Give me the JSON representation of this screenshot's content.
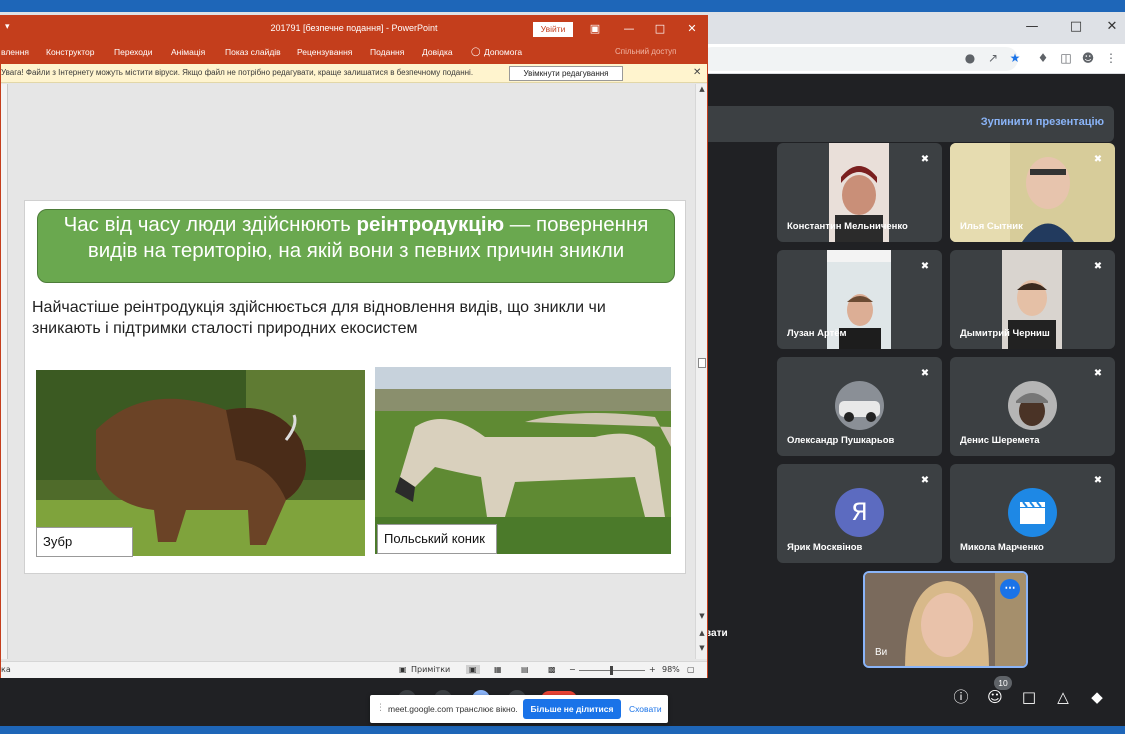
{
  "ppt": {
    "title": "201791 [безпечне подання]  -  PowerPoint",
    "signin": "Увійти",
    "ribbon_tabs": [
      "влення",
      "Конструктор",
      "Переходи",
      "Анімація",
      "Показ слайдів",
      "Рецензування",
      "Подання",
      "Довідка",
      "Допомога"
    ],
    "share": "Спільний доступ",
    "warning": "Увага! Файли з Інтернету можуть містити віруси. Якщо файл не потрібно редагувати, краще залишатися в безпечному поданні.",
    "enable_editing": "Увімкнути редагування",
    "status": {
      "left": "ка",
      "notes": "Примітки",
      "zoom": "98%"
    }
  },
  "slide": {
    "heading_pre": "Час від часу люди здійснюють ",
    "heading_bold": "реінтродукцію",
    "heading_post": " — повернення видів на територію, на якій вони з певних причин зникли",
    "body": "Найчастіше реінтродукція здійснюється для відновлення видів, що зникли чи зникають і підтримки сталості природних екосистем",
    "caption_left": "Зубр",
    "caption_right": "Польський коник"
  },
  "meet": {
    "stop_presenting": "Зупинити презентацію",
    "participants": [
      {
        "name": "Константин Мельниченко"
      },
      {
        "name": "Илья Сытник"
      },
      {
        "name": "Лузан Артём"
      },
      {
        "name": "Дымитрий Черниш"
      },
      {
        "name": "Олександр Пушкарьов"
      },
      {
        "name": "Денис Шеремета"
      },
      {
        "name": "Ярик Москвінов",
        "initial": "Я"
      },
      {
        "name": "Микола Марченко"
      }
    ],
    "self_name": "Ви",
    "partial_text": "вати",
    "people_count": "10"
  },
  "share_notice": {
    "text": "meet.google.com транслює вікно.",
    "stop": "Більше не ділитися",
    "hide": "Сховати"
  },
  "colors": {
    "ppt_accent": "#c43e1c",
    "slide_banner": "#6aa84f",
    "meet_bg": "#202124",
    "meet_link": "#8ab4f8"
  }
}
